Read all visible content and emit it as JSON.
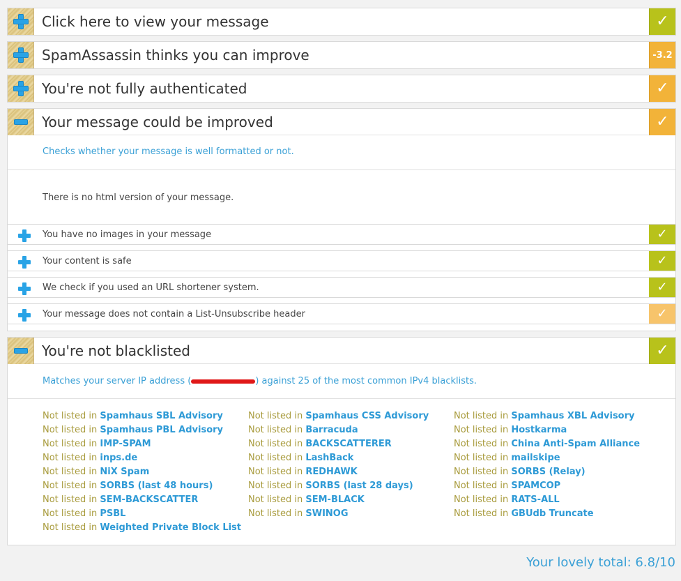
{
  "sections": {
    "view": {
      "title": "Click here to view your message"
    },
    "spam": {
      "title": "SpamAssassin thinks you can improve",
      "score": "-3.2"
    },
    "auth": {
      "title": "You're not fully authenticated"
    },
    "improve": {
      "title": "Your message could be improved",
      "description": "Checks whether your message is well formatted or not.",
      "note": "There is no html version of your message.",
      "items": [
        {
          "label": "You have no images in your message"
        },
        {
          "label": "Your content is safe"
        },
        {
          "label": "We check if you used an URL shortener system."
        },
        {
          "label": "Your message does not contain a List-Unsubscribe header"
        }
      ]
    },
    "blacklist": {
      "title": "You're not blacklisted",
      "desc_before": "Matches your server IP address (",
      "desc_after": ") against 25 of the most common IPv4 blacklists.",
      "not_listed_prefix": "Not listed in ",
      "lists": [
        "Spamhaus SBL Advisory",
        "Spamhaus PBL Advisory",
        "IMP-SPAM",
        "inps.de",
        "NiX Spam",
        "SORBS (last 48 hours)",
        "SEM-BACKSCATTER",
        "PSBL",
        "Weighted Private Block List",
        "Spamhaus CSS Advisory",
        "Barracuda",
        "BACKSCATTERER",
        "LashBack",
        "REDHAWK",
        "SORBS (last 28 days)",
        "SEM-BLACK",
        "SWINOG",
        "Spamhaus XBL Advisory",
        "Hostkarma",
        "China Anti-Spam Alliance",
        "mailskipe",
        "SORBS (Relay)",
        "SPAMCOP",
        "RATS-ALL",
        "GBUdb Truncate"
      ]
    }
  },
  "check_glyph": "✓",
  "total": "Your lovely total: 6.8/10",
  "colors": {
    "green": "#b8c21b",
    "orange": "#f2b339",
    "accent": "#2e9ad6"
  }
}
